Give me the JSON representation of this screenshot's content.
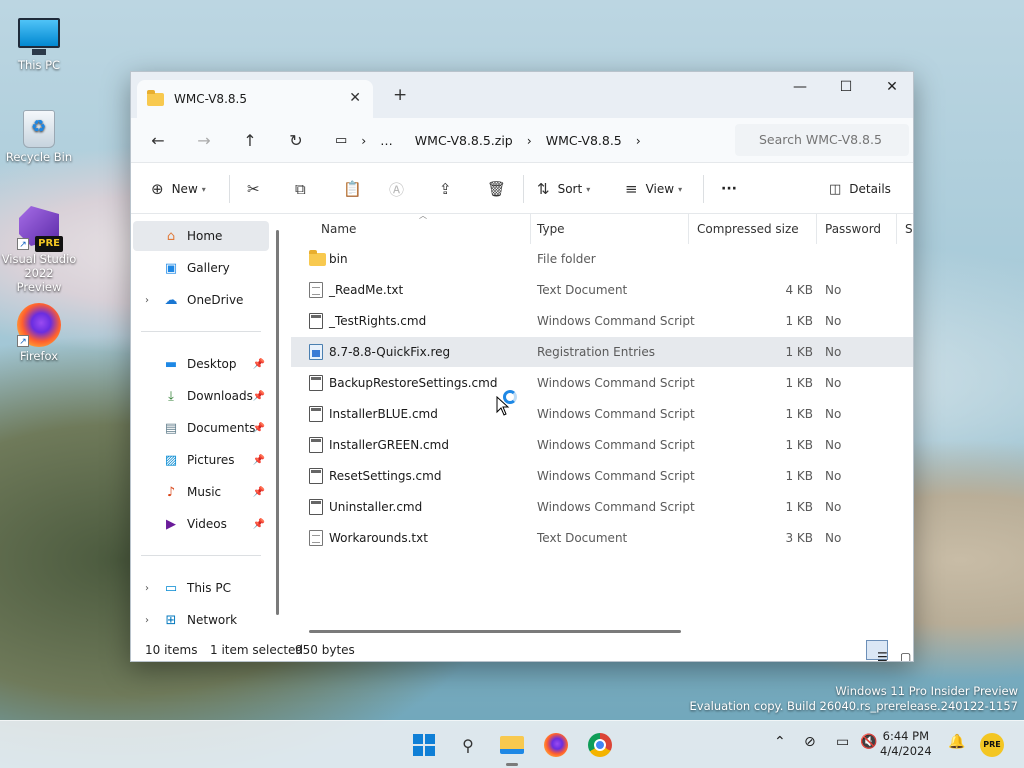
{
  "desktop": {
    "icons": [
      {
        "label": "This PC"
      },
      {
        "label": "Recycle Bin"
      },
      {
        "label": "Visual Studio 2022 Preview",
        "badge": "PRE"
      },
      {
        "label": "Firefox"
      }
    ],
    "watermark": {
      "line1": "Windows 11 Pro Insider Preview",
      "line2": "Evaluation copy. Build 26040.rs_prerelease.240122-1157"
    }
  },
  "window": {
    "tab_title": "WMC-V8.8.5",
    "controls": {
      "minimize": "—",
      "maximize": "☐",
      "close": "✕"
    },
    "address": {
      "crumbs": [
        "…",
        "WMC-V8.8.5.zip",
        "WMC-V8.8.5"
      ],
      "search_placeholder": "Search WMC-V8.8.5"
    },
    "toolbar": {
      "new_label": "New",
      "sort_label": "Sort",
      "view_label": "View",
      "more_label": "···",
      "details_label": "Details"
    },
    "sidebar": {
      "home": "Home",
      "gallery": "Gallery",
      "onedrive": "OneDrive",
      "desktop": "Desktop",
      "downloads": "Downloads",
      "documents": "Documents",
      "pictures": "Pictures",
      "music": "Music",
      "videos": "Videos",
      "thispc": "This PC",
      "network": "Network"
    },
    "columns": {
      "name": "Name",
      "type": "Type",
      "compressed": "Compressed size",
      "password": "Password ...",
      "size": "Si"
    },
    "files": [
      {
        "name": "bin",
        "type": "File folder",
        "size": "",
        "password": "",
        "kind": "folder"
      },
      {
        "name": "_ReadMe.txt",
        "type": "Text Document",
        "size": "4 KB",
        "password": "No",
        "kind": "txt"
      },
      {
        "name": "_TestRights.cmd",
        "type": "Windows Command Script",
        "size": "1 KB",
        "password": "No",
        "kind": "cmd"
      },
      {
        "name": "8.7-8.8-QuickFix.reg",
        "type": "Registration Entries",
        "size": "1 KB",
        "password": "No",
        "kind": "reg"
      },
      {
        "name": "BackupRestoreSettings.cmd",
        "type": "Windows Command Script",
        "size": "1 KB",
        "password": "No",
        "kind": "cmd"
      },
      {
        "name": "InstallerBLUE.cmd",
        "type": "Windows Command Script",
        "size": "1 KB",
        "password": "No",
        "kind": "cmd"
      },
      {
        "name": "InstallerGREEN.cmd",
        "type": "Windows Command Script",
        "size": "1 KB",
        "password": "No",
        "kind": "cmd"
      },
      {
        "name": "ResetSettings.cmd",
        "type": "Windows Command Script",
        "size": "1 KB",
        "password": "No",
        "kind": "cmd"
      },
      {
        "name": "Uninstaller.cmd",
        "type": "Windows Command Script",
        "size": "1 KB",
        "password": "No",
        "kind": "cmd"
      },
      {
        "name": "Workarounds.txt",
        "type": "Text Document",
        "size": "3 KB",
        "password": "No",
        "kind": "txt"
      }
    ],
    "status": {
      "count": "10 items",
      "selected": "1 item selected",
      "bytes": "950 bytes"
    }
  },
  "taskbar": {
    "time": "6:44 PM",
    "date": "4/4/2024",
    "notify_badge": "PRE"
  },
  "colors": {
    "accent": "#0f7fd6",
    "folder": "#f8c94f",
    "selection": "#e6e9ed"
  }
}
